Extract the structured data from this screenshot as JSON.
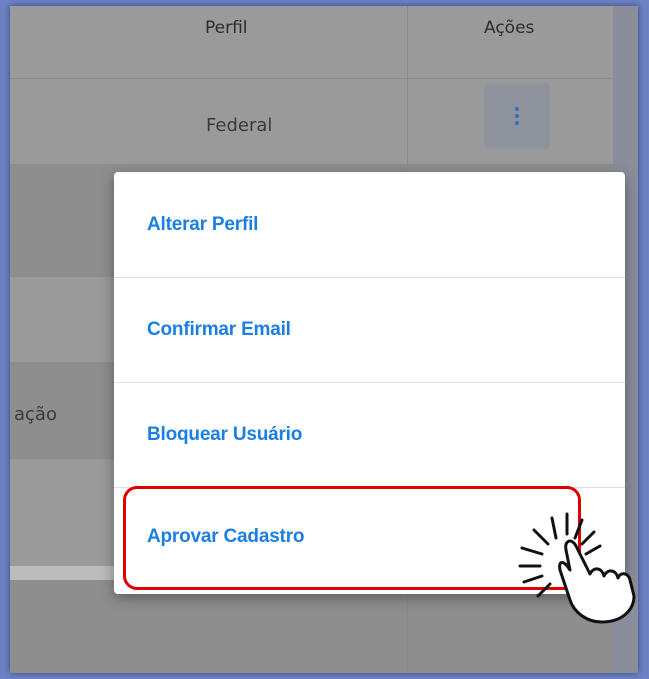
{
  "table": {
    "header": {
      "perfil": "Perfil",
      "acoes": "Ações"
    },
    "rows": [
      {
        "perfil": "Federal"
      },
      {
        "left_fragment": "ação"
      }
    ]
  },
  "dropdown_menu": {
    "items": [
      {
        "label": "Alterar Perfil"
      },
      {
        "label": "Confirmar Email"
      },
      {
        "label": "Bloquear Usuário"
      },
      {
        "label": "Aprovar Cadastro"
      }
    ]
  },
  "colors": {
    "menu_text": "#1a7fe0",
    "highlight": "#e00000",
    "kebab": "#2e6fc4"
  },
  "icons": [
    "more-vertical-icon",
    "pointer-click-icon"
  ]
}
